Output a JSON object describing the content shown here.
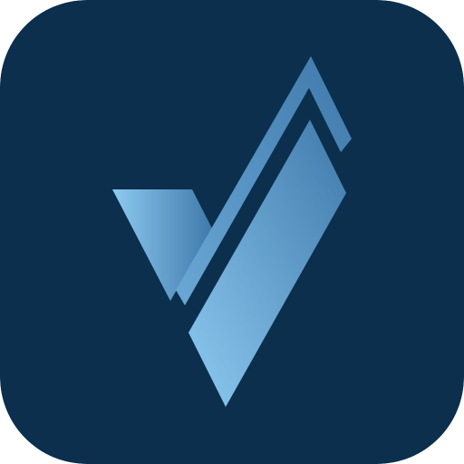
{
  "icon": {
    "name": "app-icon",
    "symbol": "v-check-logo",
    "colors": {
      "background": "#0b2f4d",
      "logo_light": "#8dcaf0",
      "logo_mid": "#6aa8d6",
      "logo_dark": "#3f79ab"
    }
  }
}
